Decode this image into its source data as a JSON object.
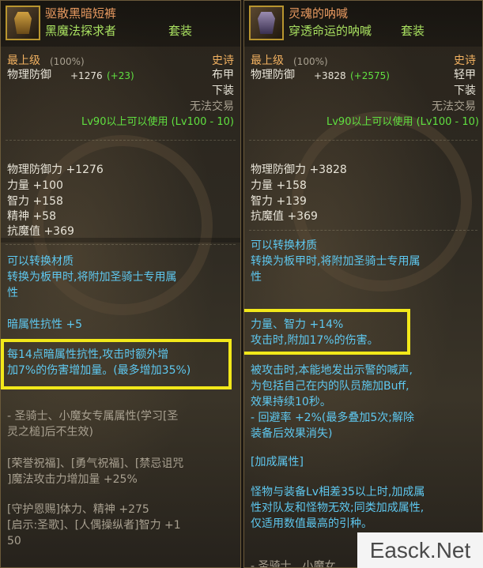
{
  "left": {
    "title": "驱散黑暗短裤",
    "subtitle": "黑魔法探求者",
    "set_label": "套装",
    "grade": "最上级",
    "grade_pct": "(100%)",
    "rarity": "史诗",
    "phys_def_label": "物理防御",
    "phys_def_value": "+1276",
    "phys_def_bonus": "(+23)",
    "armor_type": "布甲",
    "slot": "下装",
    "trade": "无法交易",
    "level_req": "Lv90以上可以使用 (Lv100 - 10)",
    "stats": [
      "物理防御力 +1276",
      "力量 +100",
      "智力 +158",
      "精神 +58",
      "抗魔值 +369"
    ],
    "convert_lines": [
      "可以转换材质",
      "转换为板甲时,将附加圣骑士专用属",
      "性"
    ],
    "dark_resist": "暗属性抗性 +5",
    "highlight_lines": [
      "每14点暗属性抗性,攻击时额外增",
      "加7%的伤害增加量。(最多增加35%)"
    ],
    "exclusive_lines": [
      "- 圣骑士、小魔女专属属性(学习[圣",
      "灵之槌]后不生效)"
    ],
    "skill_lines": [
      "[荣誉祝福]、[勇气祝福]、[禁忌诅咒",
      "]魔法攻击力增加量 +25%"
    ],
    "extra_lines": [
      "[守护恩赐]体力、精神 +275",
      "[启示:圣歌]、[人偶操纵者]智力 +1",
      "50"
    ]
  },
  "right": {
    "title": "灵魂的呐喊",
    "subtitle": "穿透命运的呐喊",
    "set_label": "套装",
    "grade": "最上级",
    "grade_pct": "(100%)",
    "rarity": "史诗",
    "phys_def_label": "物理防御",
    "phys_def_value": "+3828",
    "phys_def_bonus": "(+2575)",
    "armor_type": "轻甲",
    "slot": "下装",
    "trade": "无法交易",
    "level_req": "Lv90以上可以使用 (Lv100 - 10)",
    "stats": [
      "物理防御力 +3828",
      "力量 +158",
      "智力 +139",
      "抗魔值 +369"
    ],
    "convert_lines": [
      "可以转换材质",
      "转换为板甲时,将附加圣骑士专用属",
      "性"
    ],
    "highlight_lines": [
      "力量、智力 +14%",
      "攻击时,附加17%的伤害。"
    ],
    "shout_lines": [
      "被攻击时,本能地发出示警的喊声,",
      "为包括自己在内的队员施加Buff,",
      "效果持续10秒。",
      "- 回避率 +2%(最多叠加5次;解除",
      "装备后效果消失)"
    ],
    "bonus_header": "[加成属性]",
    "bonus_lines": [
      "怪物与装备Lv相差35以上时,加成属",
      "性对队友和怪物无效;同类加成属性,",
      "仅适用数值最高的引种。"
    ],
    "cut_line": "- 圣骑士、小魔女"
  },
  "watermark": "Easck.Net"
}
